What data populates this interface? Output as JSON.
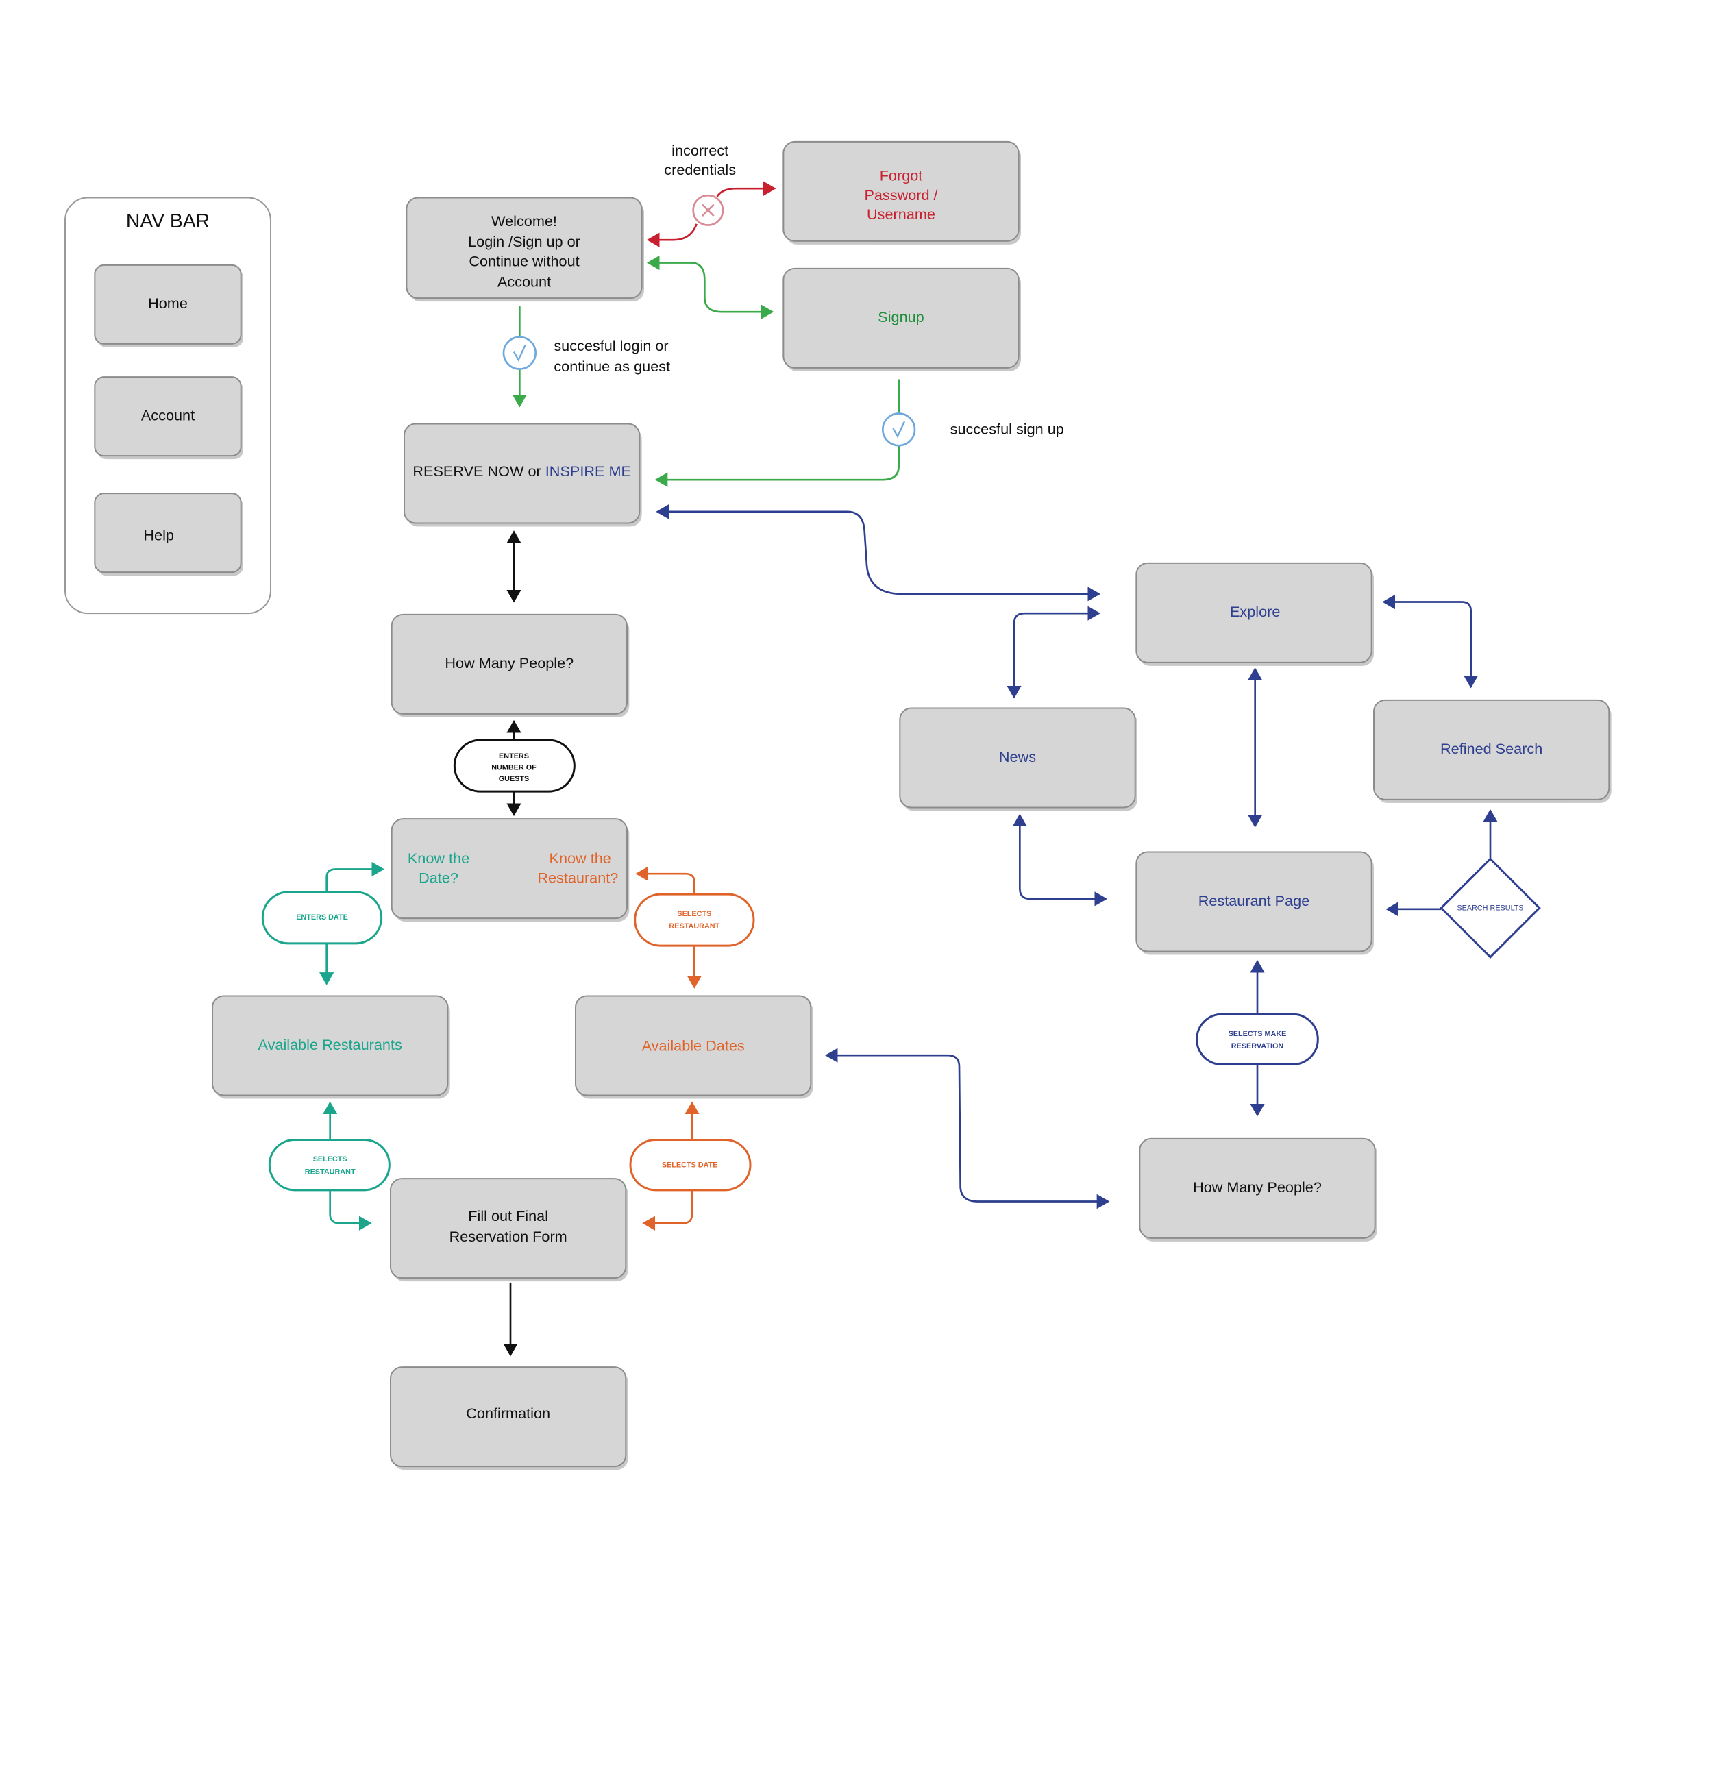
{
  "colors": {
    "red": "#c8202e",
    "green": "#3aaa4a",
    "teal": "#1aa58c",
    "orange": "#e0632a",
    "navy": "#2e3f8f",
    "check": "#6fa8dc",
    "box": "#d6d6d6"
  },
  "nav_bar": {
    "title": "NAV BAR",
    "items": [
      {
        "label": "Home"
      },
      {
        "label": "Account"
      },
      {
        "label": "Help"
      }
    ]
  },
  "nodes": {
    "welcome": {
      "lines": [
        "Welcome!",
        "Login /Sign up or",
        "Continue without",
        "Account"
      ]
    },
    "forgot": {
      "lines": [
        "Forgot",
        "Password /",
        "Username"
      ]
    },
    "signup": {
      "label": "Signup"
    },
    "reserve": {
      "part1": "RESERVE NOW",
      "part2": "or",
      "part3": "INSPIRE ME"
    },
    "how_many_1": {
      "label": "How Many People?"
    },
    "know": {
      "date_lines": [
        "Know the",
        "Date?"
      ],
      "restaurant_lines": [
        "Know the",
        "Restaurant?"
      ]
    },
    "available_restaurants": {
      "label": "Available Restaurants"
    },
    "available_dates": {
      "label": "Available Dates"
    },
    "fill_form": {
      "lines": [
        "Fill out Final",
        "Reservation Form"
      ]
    },
    "confirmation": {
      "label": "Confirmation"
    },
    "explore": {
      "label": "Explore"
    },
    "news": {
      "label": "News"
    },
    "refined_search": {
      "label": "Refined Search"
    },
    "restaurant_page": {
      "label": "Restaurant Page"
    },
    "how_many_2": {
      "label": "How Many People?"
    }
  },
  "annotations": {
    "incorrect": [
      "incorrect",
      "credentials"
    ],
    "login_success": [
      "succesful login or",
      "continue as guest"
    ],
    "signup_success": "succesful sign up"
  },
  "pills": {
    "guests": [
      "ENTERS",
      "NUMBER OF",
      "GUESTS"
    ],
    "enters_date": [
      "ENTERS DATE"
    ],
    "selects_restaurant_orange": [
      "SELECTS",
      "RESTAURANT"
    ],
    "selects_restaurant_teal": [
      "SELECTS",
      "RESTAURANT"
    ],
    "selects_date": [
      "SELECTS DATE"
    ],
    "selects_make_reservation": [
      "SELECTS MAKE",
      "RESERVATION"
    ]
  },
  "decision": {
    "label": "SEARCH RESULTS"
  },
  "icons": {
    "fail": "x-circle-icon",
    "success": "check-circle-icon"
  }
}
